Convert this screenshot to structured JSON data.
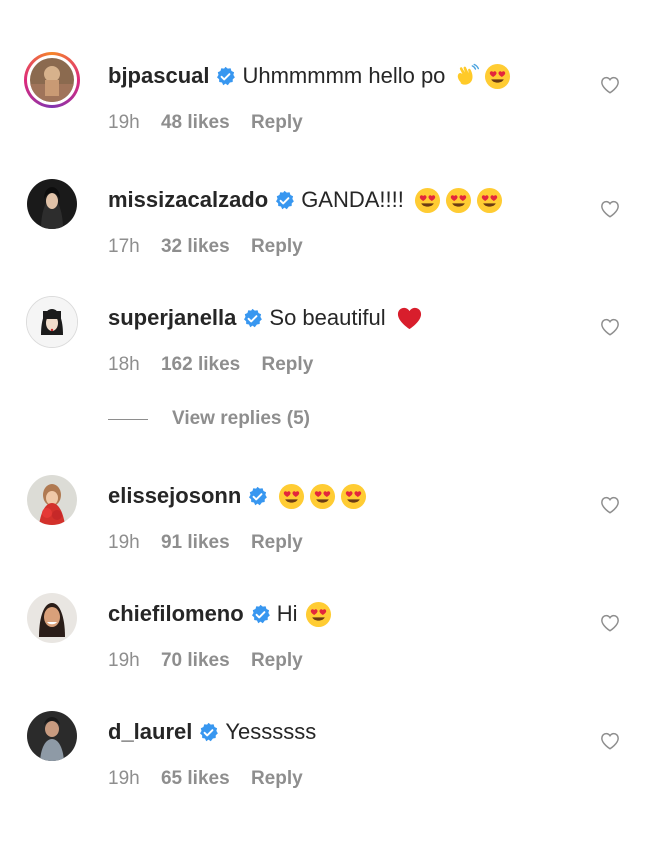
{
  "comments": [
    {
      "username": "bjpascual",
      "text": "Uhmmmmm hello po",
      "emojis": [
        "waving-hand",
        "heart-eyes"
      ],
      "time": "19h",
      "likes": "48 likes",
      "reply": "Reply",
      "story_ring": true
    },
    {
      "username": "missizacalzado",
      "text": "GANDA!!!!",
      "emojis": [
        "heart-eyes",
        "heart-eyes",
        "heart-eyes"
      ],
      "time": "17h",
      "likes": "32 likes",
      "reply": "Reply",
      "story_ring": false
    },
    {
      "username": "superjanella",
      "text": "So beautiful",
      "emojis": [
        "red-heart"
      ],
      "time": "18h",
      "likes": "162 likes",
      "reply": "Reply",
      "story_ring": false
    },
    {
      "username": "elissejosonn",
      "text": "",
      "emojis": [
        "heart-eyes",
        "heart-eyes",
        "heart-eyes"
      ],
      "time": "19h",
      "likes": "91 likes",
      "reply": "Reply",
      "story_ring": false
    },
    {
      "username": "chiefilomeno",
      "text": "Hi",
      "emojis": [
        "heart-eyes"
      ],
      "time": "19h",
      "likes": "70 likes",
      "reply": "Reply",
      "story_ring": false
    },
    {
      "username": "d_laurel",
      "text": "Yessssss",
      "emojis": [],
      "time": "19h",
      "likes": "65 likes",
      "reply": "Reply",
      "story_ring": false
    }
  ],
  "view_replies": "View replies (5)",
  "colors": {
    "verified": "#3897f0",
    "muted": "#8e8e8e",
    "text": "#262626"
  },
  "icons": {
    "like": "heart-outline-icon",
    "verified": "verified-badge-icon"
  }
}
